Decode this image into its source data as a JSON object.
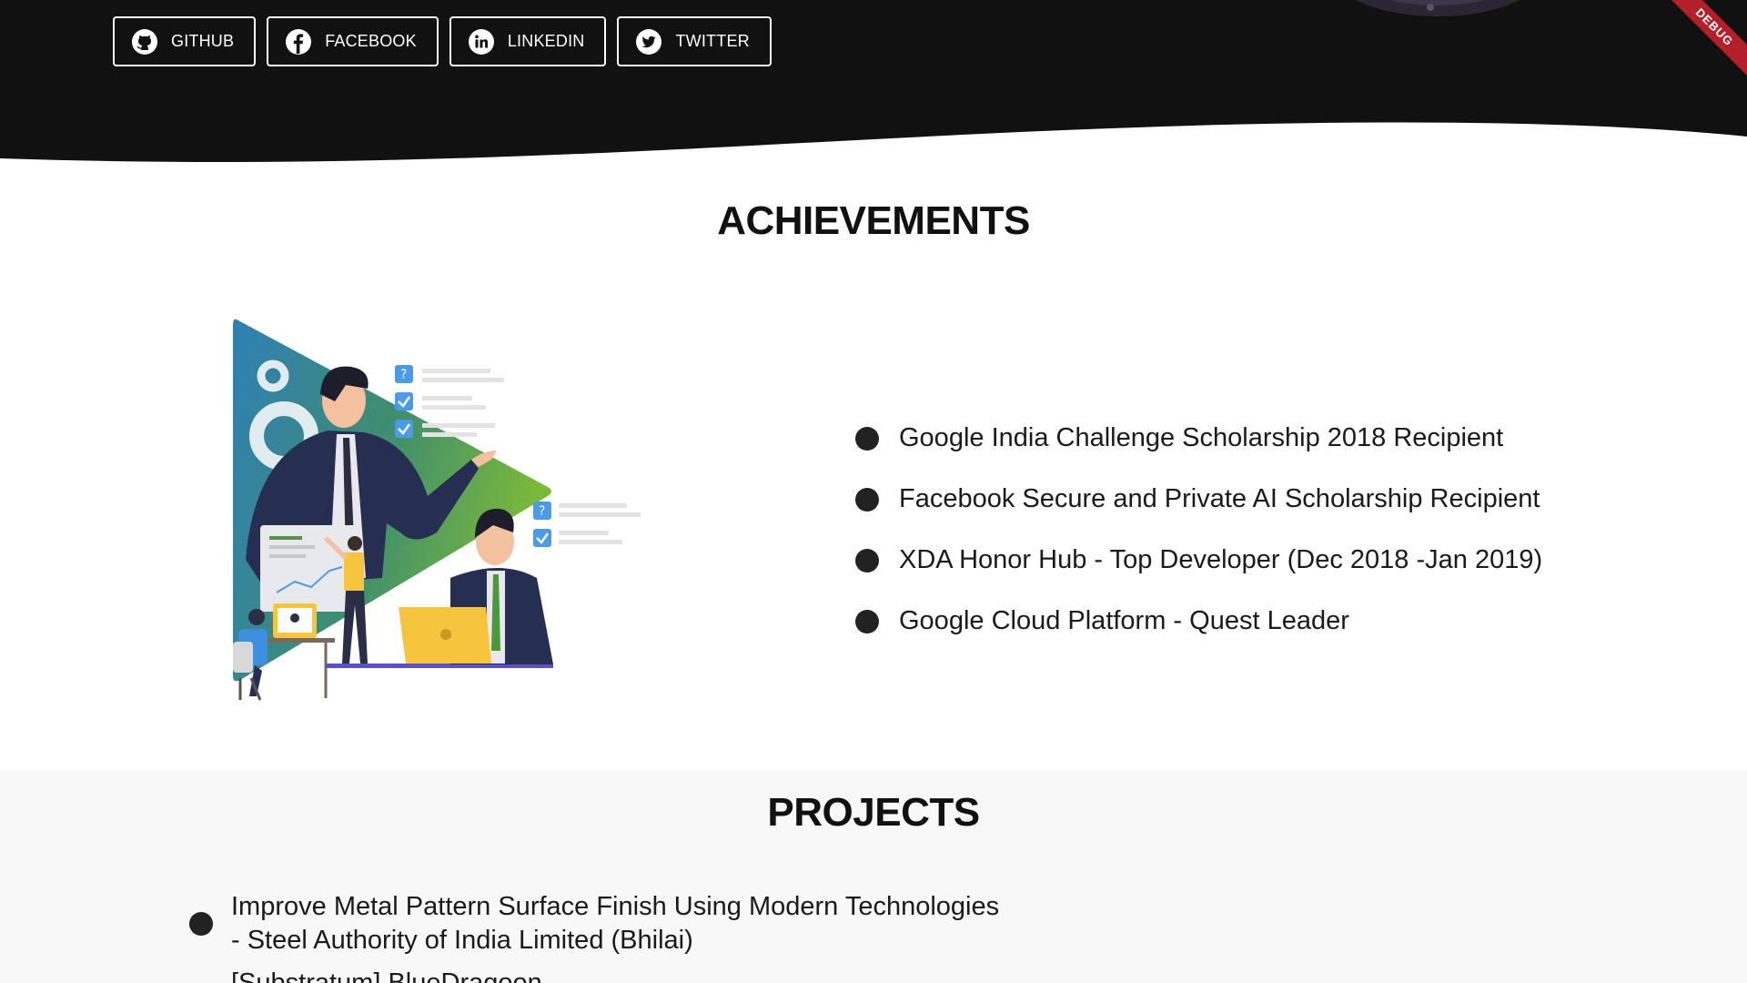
{
  "header": {
    "social_buttons": [
      {
        "label": "GITHUB",
        "icon": "github-icon"
      },
      {
        "label": "FACEBOOK",
        "icon": "facebook-icon"
      },
      {
        "label": "LINKEDIN",
        "icon": "linkedin-icon"
      },
      {
        "label": "TWITTER",
        "icon": "twitter-icon"
      }
    ],
    "debug_banner": "DEBUG",
    "colors": {
      "background": "#111111",
      "text": "#ffffff"
    }
  },
  "achievements": {
    "title": "ACHIEVEMENTS",
    "items": [
      "Google India Challenge Scholarship 2018 Recipient",
      "Facebook Secure and Private AI Scholarship Recipient",
      "XDA Honor Hub - Top Developer (Dec 2018 -Jan 2019)",
      "Google Cloud Platform - Quest Leader"
    ]
  },
  "projects": {
    "title": "PROJECTS",
    "items": [
      {
        "line1": "Improve Metal Pattern Surface Finish Using Modern Technologies",
        "line2": "- Steel Authority of India Limited (Bhilai)"
      },
      {
        "line1": "[Substratum] BlueDragoon",
        "line2": ""
      }
    ]
  }
}
